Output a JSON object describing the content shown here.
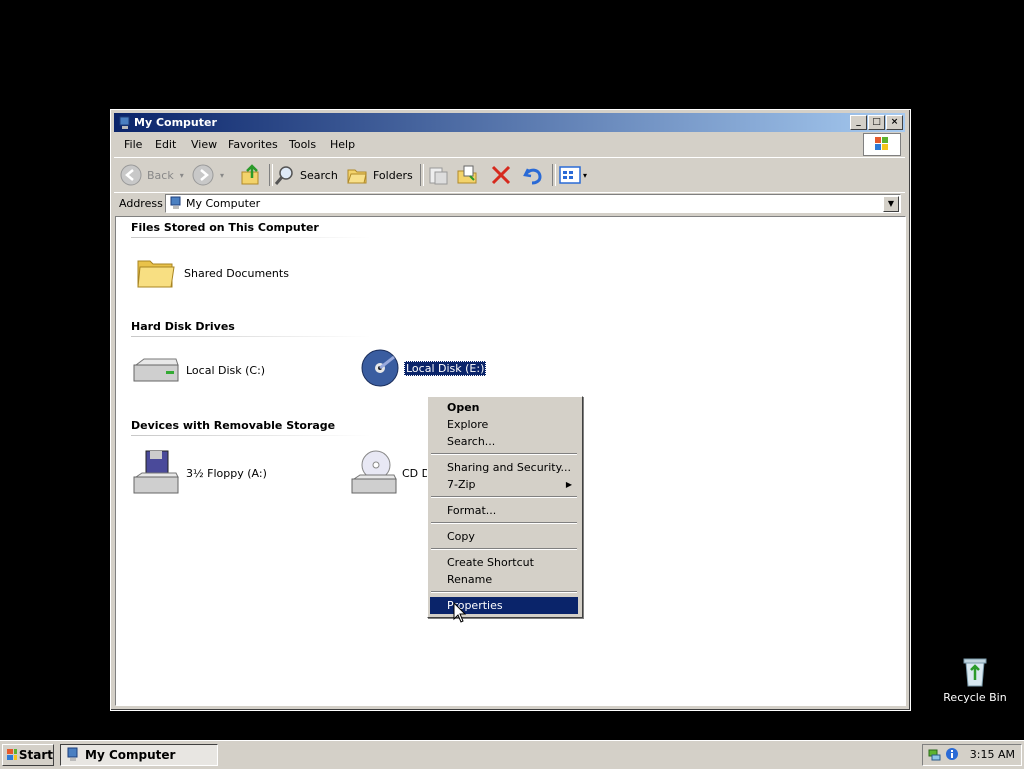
{
  "window": {
    "title": "My Computer",
    "menu": [
      "File",
      "Edit",
      "View",
      "Favorites",
      "Tools",
      "Help"
    ],
    "toolbar": {
      "back": "Back",
      "search": "Search",
      "folders": "Folders"
    },
    "address": {
      "label": "Address",
      "value": "My Computer"
    }
  },
  "groups": {
    "files": {
      "title": "Files Stored on This Computer",
      "items": [
        "Shared Documents"
      ]
    },
    "hdd": {
      "title": "Hard Disk Drives",
      "items": [
        "Local Disk (C:)",
        "Local Disk (E:)"
      ]
    },
    "removable": {
      "title": "Devices with Removable Storage",
      "items": [
        "3½ Floppy (A:)",
        "CD D"
      ]
    }
  },
  "context_menu": {
    "items": [
      "Open",
      "Explore",
      "Search...",
      "Sharing and Security...",
      "7-Zip",
      "Format...",
      "Copy",
      "Create Shortcut",
      "Rename",
      "Properties"
    ],
    "selected": "Properties"
  },
  "desktop": {
    "recycle_bin": "Recycle Bin"
  },
  "taskbar": {
    "start": "Start",
    "task": "My Computer",
    "clock": "3:15 AM"
  }
}
